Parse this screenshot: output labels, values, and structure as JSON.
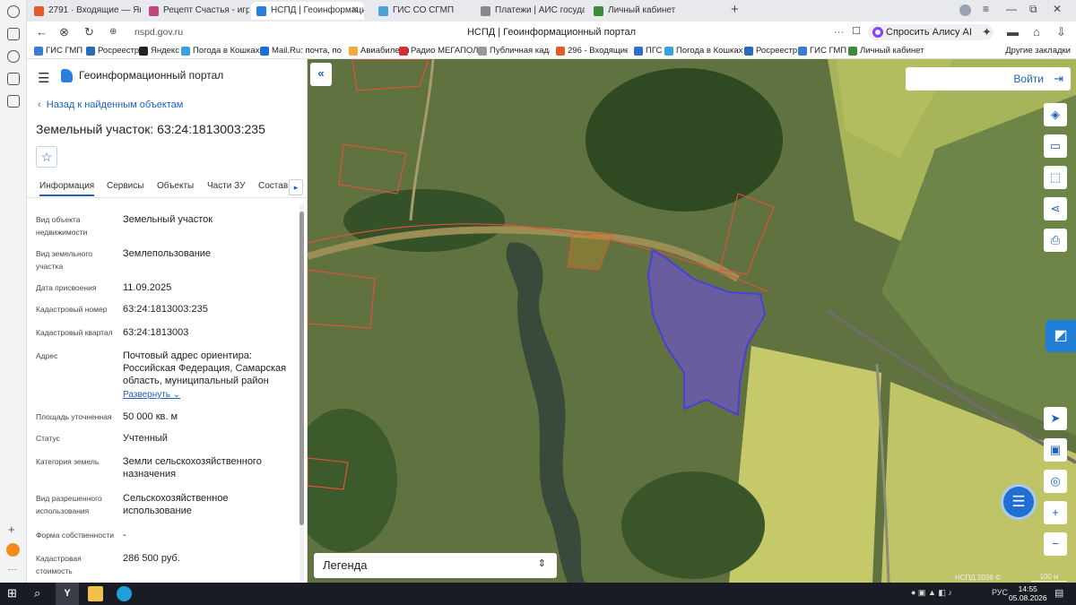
{
  "browser": {
    "tabs": [
      {
        "label": "2791 · Входящие — Янде",
        "color": "#e45b2a"
      },
      {
        "label": "Рецепт Счастья - играть с",
        "color": "#c2457c"
      },
      {
        "label": "НСПД | Геоинформаци",
        "color": "#2a7de1",
        "active": true
      },
      {
        "label": "ГИС СО СГМП",
        "color": "#4e9fd6"
      },
      {
        "label": "Платежи | АИС государс",
        "color": "#888888"
      },
      {
        "label": "Личный кабинет",
        "color": "#3b8b3b"
      }
    ],
    "tab_close": "✕",
    "new_tab": "+",
    "url": "nspd.gov.ru",
    "page_title": "НСПД | Геоинформационный портал",
    "more": "···",
    "alisa": "Спросить Алису AI",
    "bookmarks": [
      {
        "label": "ГИС ГМП",
        "color": "#3a7bd5"
      },
      {
        "label": "Росреестр",
        "color": "#2a6ab8"
      },
      {
        "label": "Яндекс",
        "color": "#222222"
      },
      {
        "label": "Погода в Кошках",
        "color": "#3aa0e0"
      },
      {
        "label": "Mail.Ru: почта, по",
        "color": "#1b6fd1"
      },
      {
        "label": "Авиабилеты",
        "color": "#f2a93b"
      },
      {
        "label": "Радио МЕГАПОЛ",
        "color": "#d82d2d"
      },
      {
        "label": "Публичная кадас",
        "color": "#999999"
      },
      {
        "label": "296 - Входящие –",
        "color": "#e45b2a"
      },
      {
        "label": "ПГС",
        "color": "#2d6fd0"
      },
      {
        "label": "Погода в Кошках",
        "color": "#3aa0e0"
      },
      {
        "label": "Росреестр",
        "color": "#2a6ab8"
      },
      {
        "label": "ГИС ГМП",
        "color": "#3a7bd5"
      },
      {
        "label": "Личный кабинет",
        "color": "#3b8b3b"
      }
    ],
    "other_bookmarks": "Другие закладки"
  },
  "panel": {
    "portal_title": "Геоинформационный портал",
    "back_link": "Назад к найденным объектам",
    "object_title": "Земельный участок: 63:24:1813003:235",
    "tabs": [
      "Информация",
      "Сервисы",
      "Объекты",
      "Части ЗУ",
      "Состав"
    ],
    "properties": [
      {
        "label": "Вид объекта недвижимости",
        "value": "Земельный участок"
      },
      {
        "label": "Вид земельного участка",
        "value": "Землепользование"
      },
      {
        "label": "Дата присвоения",
        "value": "11.09.2025"
      },
      {
        "label": "Кадастровый номер",
        "value": "63:24:1813003:235"
      },
      {
        "label": "Кадастровый квартал",
        "value": "63:24:1813003"
      },
      {
        "label": "Адрес",
        "value": "Почтовый адрес ориентира: Российская Федерация, Самарская область, муниципальный район"
      },
      {
        "label": "Площадь уточненная",
        "value": "50 000 кв. м"
      },
      {
        "label": "Статус",
        "value": "Учтенный"
      },
      {
        "label": "Категория земель",
        "value": "Земли сельскохозяйственного назначения"
      },
      {
        "label": "Вид разрешенного использования",
        "value": "Сельскохозяйственное использование"
      },
      {
        "label": "Форма собственности",
        "value": "-"
      },
      {
        "label": "Кадастровая стоимость",
        "value": "286 500 руб."
      }
    ],
    "expand_label": "Развернуть"
  },
  "map": {
    "login": "Войти",
    "legend": "Легенда",
    "copyright": "НСПД 2026 ©",
    "scale": "100 м",
    "collapse_glyph": "«"
  },
  "taskbar": {
    "lang": "РУС",
    "time": "14:55",
    "date": "05.08.2026"
  }
}
